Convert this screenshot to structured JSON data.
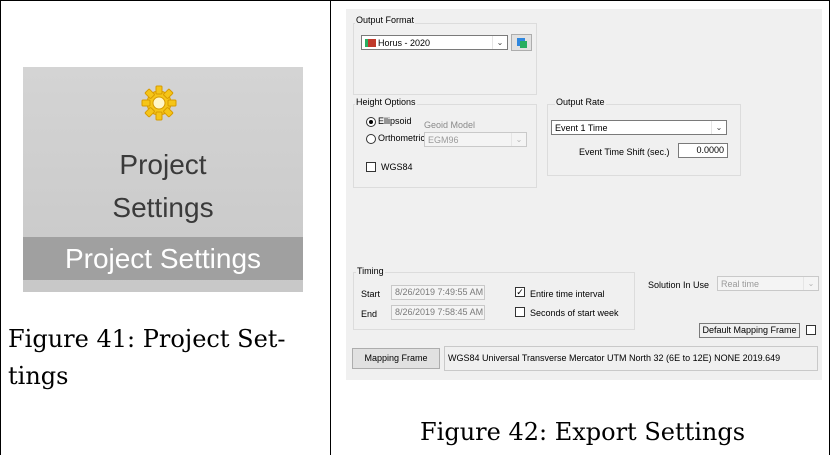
{
  "ribbon": {
    "label_line1": "Project",
    "label_line2": "Settings",
    "tooltip": "Project Settings",
    "icon": "gear-icon",
    "icon_color": "#f5c518"
  },
  "figure41": {
    "line1": "Figure 41: Project Set-",
    "line2": "tings"
  },
  "figure42": {
    "caption": "Figure 42: Export Settings"
  },
  "dialog": {
    "output_format": {
      "title": "Output Format",
      "selected": "Horus - 2020",
      "icon": "format-icon"
    },
    "height_options": {
      "title": "Height Options",
      "ellipsoid": "Ellipsoid",
      "orthometric": "Orthometric",
      "geoid_label": "Geoid Model",
      "geoid_value": "EGM96",
      "wgs84": "WGS84"
    },
    "output_rate": {
      "title": "Output Rate",
      "selected": "Event 1 Time",
      "shift_label": "Event Time Shift (sec.)",
      "shift_value": "0.0000"
    },
    "timing": {
      "title": "Timing",
      "start_label": "Start",
      "start_value": "8/26/2019 7:49:55 AM",
      "end_label": "End",
      "end_value": "8/26/2019 7:58:45 AM",
      "entire_interval": "Entire time interval",
      "seconds_of_week": "Seconds of start week"
    },
    "solution": {
      "label": "Solution In Use",
      "value": "Real time"
    },
    "default_mapping_frame": "Default Mapping Frame",
    "mapping_frame": {
      "button": "Mapping Frame",
      "value": "WGS84 Universal Transverse Mercator UTM North 32 (6E to 12E) NONE  2019.649"
    }
  }
}
